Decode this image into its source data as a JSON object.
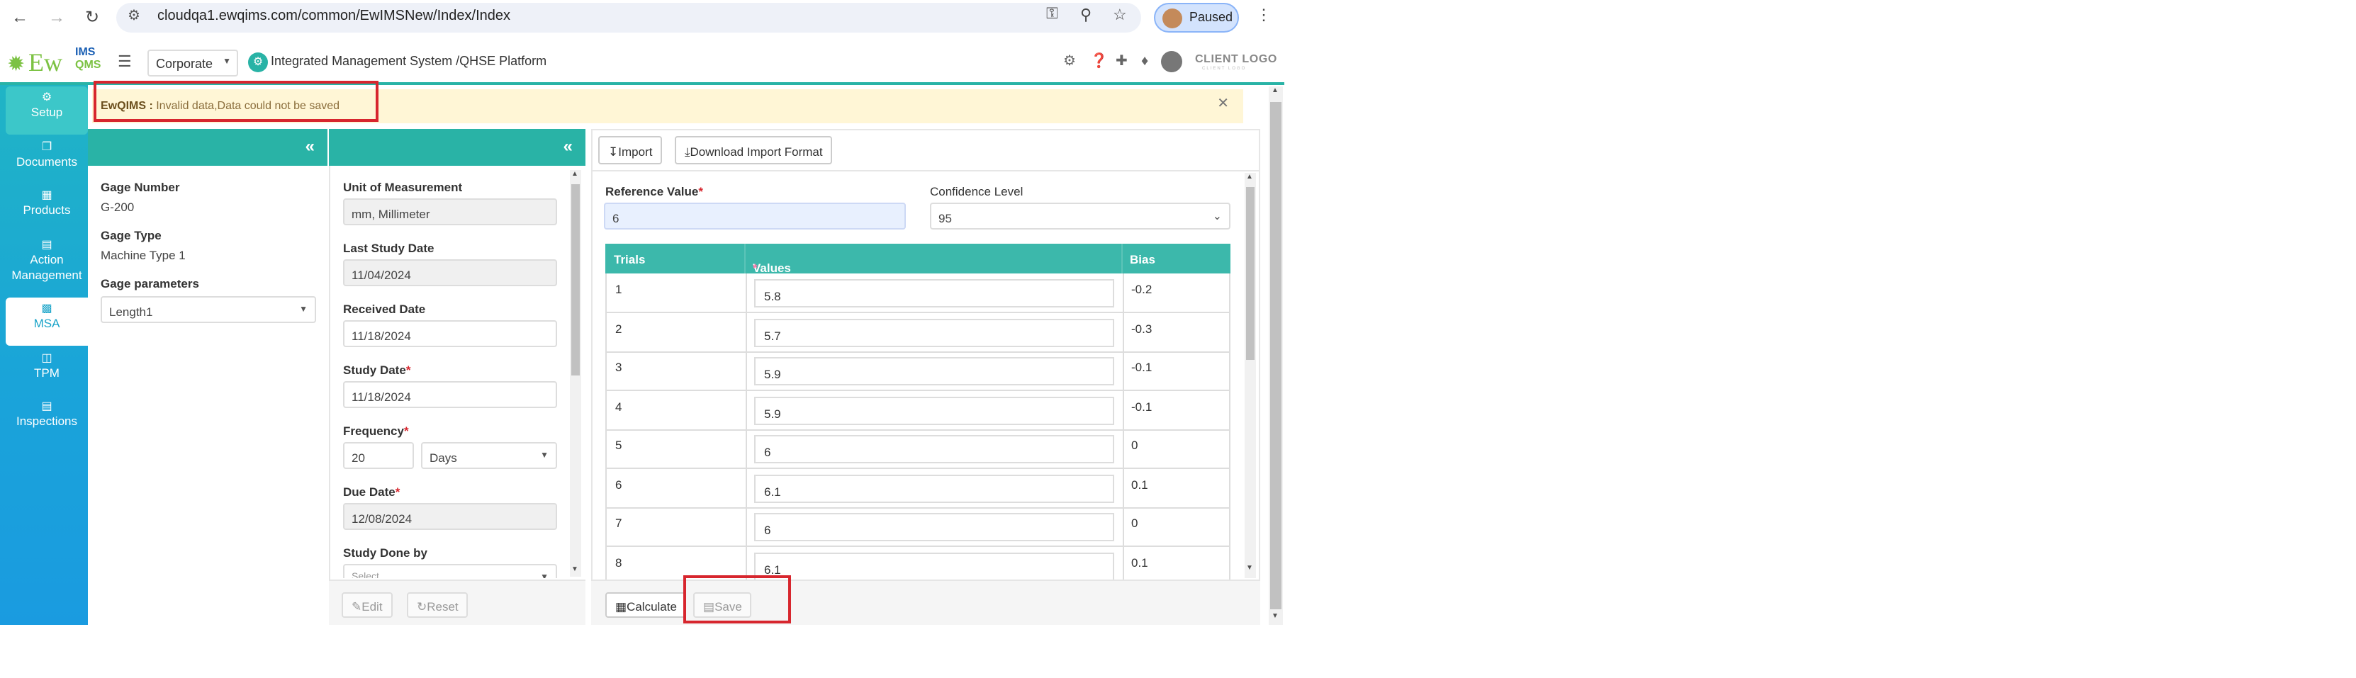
{
  "browser": {
    "url": "cloudqa1.ewqims.com/common/EwIMSNew/Index/Index",
    "profile_status": "Paused"
  },
  "header": {
    "logo_ew": "Ew",
    "logo_ims": "IMS",
    "logo_qms": "QMS",
    "org_select": "Corporate",
    "breadcrumb": "Integrated Management System /QHSE Platform",
    "client_logo": "CLIENT LOGO",
    "client_logo_sub": "CLIENT LOGO"
  },
  "sidebar": {
    "items": [
      {
        "label": "Setup",
        "icon": "gears-icon"
      },
      {
        "label": "Documents",
        "icon": "documents-icon"
      },
      {
        "label": "Products",
        "icon": "products-icon"
      },
      {
        "label": "Action Management",
        "icon": "action-icon"
      },
      {
        "label": "MSA",
        "icon": "chart-icon"
      },
      {
        "label": "TPM",
        "icon": "tpm-icon"
      },
      {
        "label": "Inspections",
        "icon": "inspections-icon"
      }
    ]
  },
  "alert": {
    "prefix": "EwQIMS :",
    "message": " Invalid data,Data could not be saved"
  },
  "left_panel": {
    "gage_number_label": "Gage Number",
    "gage_number": "G-200",
    "gage_type_label": "Gage Type",
    "gage_type": "Machine Type 1",
    "gage_params_label": "Gage parameters",
    "gage_params": "Length1"
  },
  "mid_panel": {
    "uom_label": "Unit of Measurement",
    "uom": "mm, Millimeter",
    "last_study_label": "Last Study Date",
    "last_study": "11/04/2024",
    "received_label": "Received Date",
    "received": "11/18/2024",
    "study_date_label": "Study Date",
    "study_date": "11/18/2024",
    "frequency_label": "Frequency",
    "frequency": "20",
    "frequency_unit": "Days",
    "due_date_label": "Due Date",
    "due_date": "12/08/2024",
    "study_done_label": "Study Done by",
    "study_done_placeholder": "Select",
    "edit_label": "Edit",
    "reset_label": "Reset"
  },
  "main": {
    "import_label": "Import",
    "download_label": "Download Import Format",
    "ref_label": "Reference Value",
    "ref_value": "6",
    "conf_label": "Confidence Level",
    "conf_value": "95",
    "headers": {
      "trials": "Trials",
      "values": "Values",
      "bias": "Bias"
    },
    "rows": [
      {
        "trial": "1",
        "value": "5.8",
        "bias": "-0.2"
      },
      {
        "trial": "2",
        "value": "5.7",
        "bias": "-0.3"
      },
      {
        "trial": "3",
        "value": "5.9",
        "bias": "-0.1"
      },
      {
        "trial": "4",
        "value": "5.9",
        "bias": "-0.1"
      },
      {
        "trial": "5",
        "value": "6",
        "bias": "0"
      },
      {
        "trial": "6",
        "value": "6.1",
        "bias": "0.1"
      },
      {
        "trial": "7",
        "value": "6",
        "bias": "0"
      },
      {
        "trial": "8",
        "value": "6.1",
        "bias": "0.1"
      }
    ],
    "calculate_label": "Calculate",
    "save_label": "Save"
  },
  "colors": {
    "accent": "#29b3a6",
    "sidebar_top": "#20b4c5",
    "sidebar_bottom": "#1a9be0",
    "alert_bg": "#fff6d6",
    "highlight": "#d7262e"
  }
}
